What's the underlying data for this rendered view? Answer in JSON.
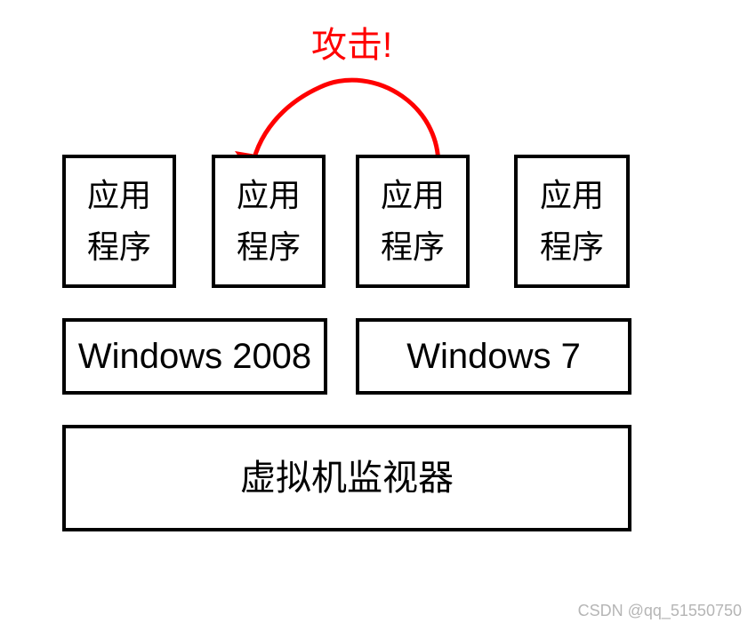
{
  "attack": {
    "label": "攻击!"
  },
  "apps": {
    "a1_l1": "应用",
    "a1_l2": "程序",
    "a2_l1": "应用",
    "a2_l2": "程序",
    "a3_l1": "应用",
    "a3_l2": "程序",
    "a4_l1": "应用",
    "a4_l2": "程序"
  },
  "os": {
    "left": "Windows 2008",
    "right": "Windows 7"
  },
  "hypervisor": {
    "label": "虚拟机监视器"
  },
  "watermark": "CSDN @qq_51550750"
}
